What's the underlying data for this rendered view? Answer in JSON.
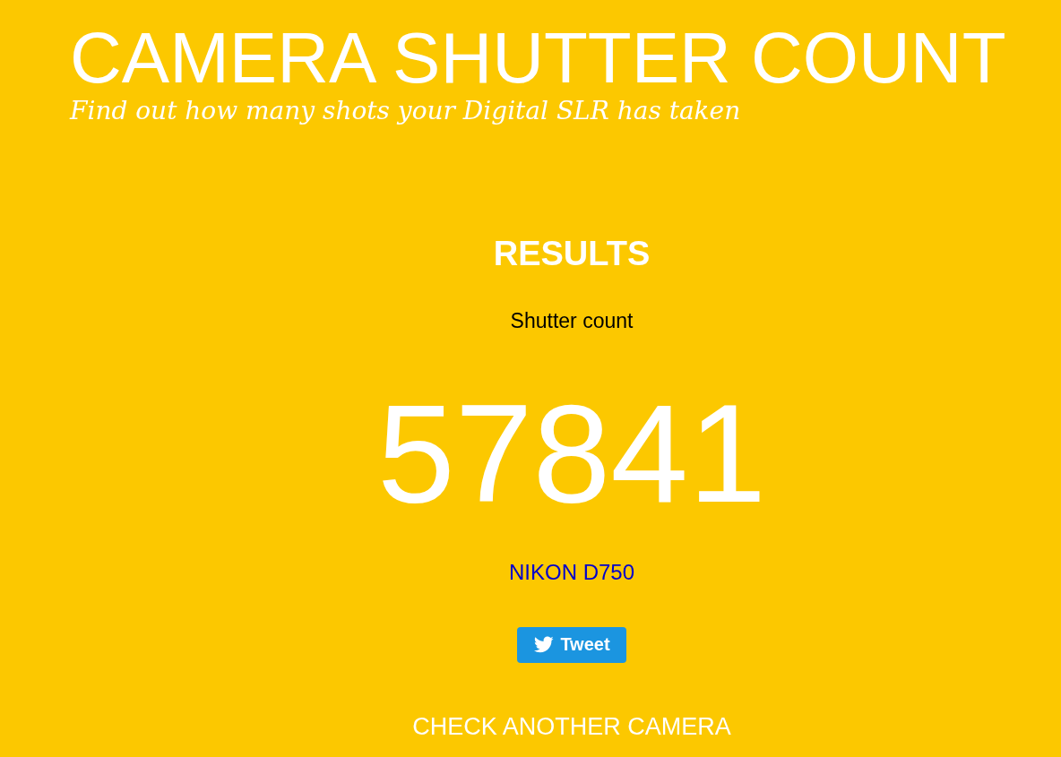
{
  "header": {
    "title": "CAMERA SHUTTER COUNT",
    "subtitle": "Find out how many shots your Digital SLR has taken"
  },
  "results": {
    "heading": "RESULTS",
    "label": "Shutter count",
    "count": "57841",
    "camera_model": "NIKON D750",
    "tweet_button": "Tweet",
    "check_another_link": "CHECK ANOTHER CAMERA"
  }
}
